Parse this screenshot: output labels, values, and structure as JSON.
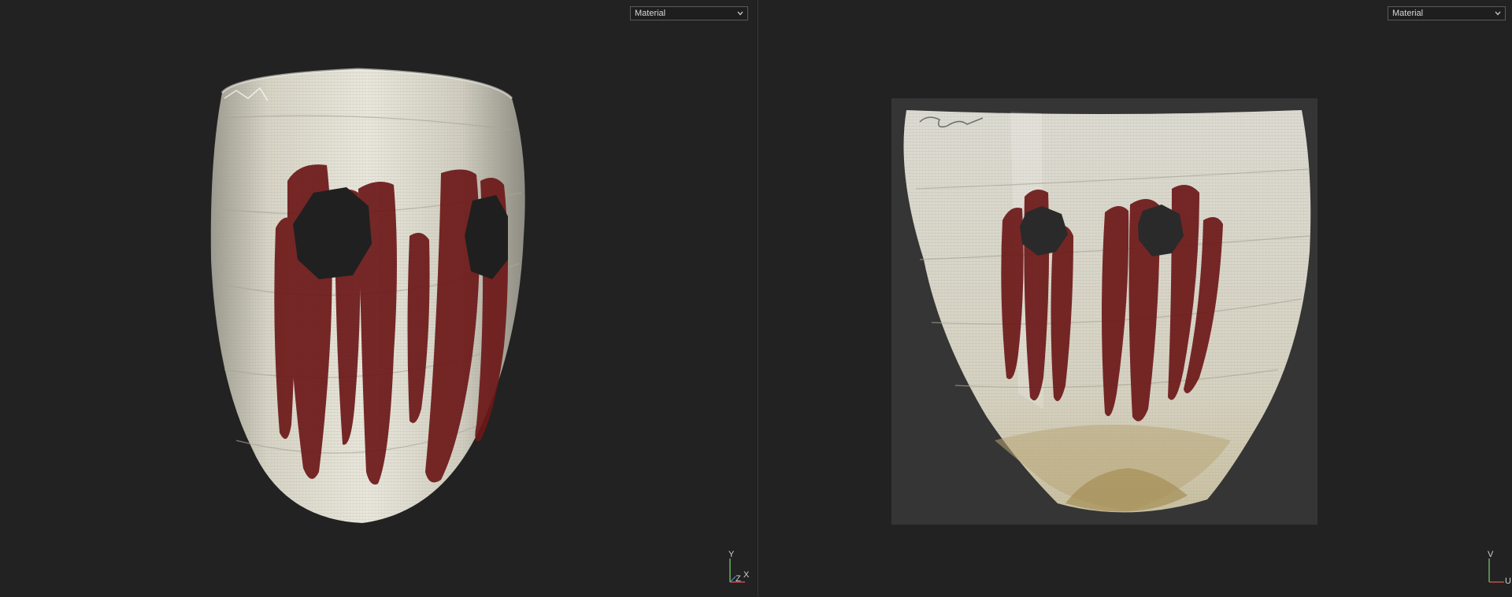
{
  "viewport_3d": {
    "channel_selector": {
      "value": "Material"
    },
    "axis_gizmo": {
      "y": "Y",
      "z": "Z",
      "x": "X"
    }
  },
  "viewport_2d": {
    "channel_selector": {
      "value": "Material"
    },
    "axis_gizmo": {
      "v": "V",
      "u": "U"
    }
  },
  "colors": {
    "background": "#222222",
    "mask_cloth": "#d9d6c8",
    "paint": "#6e1a1a",
    "uv_backdrop": "#353535"
  }
}
